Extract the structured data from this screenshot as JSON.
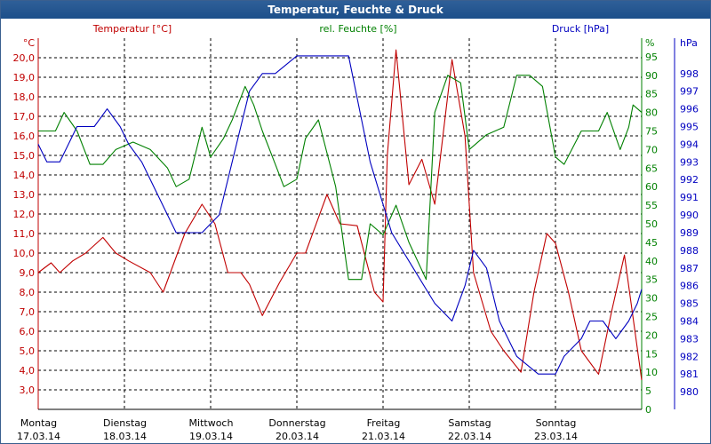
{
  "window": {
    "title": "Temperatur, Feuchte & Druck"
  },
  "legend": {
    "temperature": "Temperatur [°C]",
    "humidity": "rel. Feuchte [%]",
    "pressure": "Druck [hPa]"
  },
  "colors": {
    "temperature": "#c00000",
    "humidity": "#008000",
    "pressure": "#0000c0",
    "grid": "#000000"
  },
  "chart_data": {
    "type": "line",
    "title": "Temperatur, Feuchte & Druck",
    "grid": true,
    "x_unit": "days",
    "x_range": [
      0,
      7
    ],
    "x_ticks": [
      {
        "day": "Montag",
        "date": "17.03.14"
      },
      {
        "day": "Dienstag",
        "date": "18.03.14"
      },
      {
        "day": "Mittwoch",
        "date": "19.03.14"
      },
      {
        "day": "Donnerstag",
        "date": "20.03.14"
      },
      {
        "day": "Freitag",
        "date": "21.03.14"
      },
      {
        "day": "Samstag",
        "date": "22.03.14"
      },
      {
        "day": "Sonntag",
        "date": "23.03.14"
      }
    ],
    "axes": {
      "temperature": {
        "unit": "°C",
        "range": [
          2.0,
          21.0
        ],
        "ticks": [
          "3,0",
          "4,0",
          "5,0",
          "6,0",
          "7,0",
          "8,0",
          "9,0",
          "10,0",
          "11,0",
          "12,0",
          "13,0",
          "14,0",
          "15,0",
          "16,0",
          "17,0",
          "18,0",
          "19,0",
          "20,0"
        ]
      },
      "humidity": {
        "unit": "%",
        "range": [
          0,
          100
        ],
        "ticks": [
          "0",
          "5",
          "10",
          "15",
          "20",
          "25",
          "30",
          "35",
          "40",
          "45",
          "50",
          "55",
          "60",
          "65",
          "70",
          "75",
          "80",
          "85",
          "90",
          "95"
        ]
      },
      "pressure": {
        "unit": "hPa",
        "range": [
          979,
          1000
        ],
        "ticks": [
          "980",
          "981",
          "982",
          "983",
          "984",
          "985",
          "986",
          "987",
          "988",
          "989",
          "990",
          "991",
          "992",
          "993",
          "994",
          "995",
          "996",
          "997",
          "998"
        ]
      }
    },
    "series": [
      {
        "name": "Temperatur [°C]",
        "axis": "temperature",
        "x": [
          0,
          0.15,
          0.25,
          0.4,
          0.55,
          0.75,
          0.9,
          1.05,
          1.3,
          1.45,
          1.7,
          1.9,
          2.05,
          2.2,
          2.35,
          2.45,
          2.6,
          2.8,
          3.0,
          3.1,
          3.35,
          3.5,
          3.7,
          3.9,
          4.0,
          4.05,
          4.15,
          4.3,
          4.45,
          4.6,
          4.8,
          4.95,
          5.05,
          5.25,
          5.4,
          5.6,
          5.75,
          5.9,
          6.0,
          6.15,
          6.3,
          6.5,
          6.65,
          6.8,
          7.0
        ],
        "values": [
          9.0,
          9.5,
          9.0,
          9.6,
          10.0,
          10.8,
          10.0,
          9.6,
          9.0,
          8.0,
          11.0,
          12.5,
          11.5,
          9.0,
          9.0,
          8.4,
          6.8,
          8.5,
          10.0,
          10.0,
          13.0,
          11.5,
          11.4,
          8.0,
          7.5,
          15.0,
          20.4,
          13.5,
          14.8,
          12.5,
          19.9,
          16.0,
          9.0,
          6.0,
          5.0,
          3.9,
          8.0,
          11.0,
          10.5,
          8.0,
          5.0,
          3.8,
          7.0,
          9.9,
          3.5
        ]
      },
      {
        "name": "rel. Feuchte [%]",
        "axis": "humidity",
        "x": [
          0,
          0.2,
          0.3,
          0.45,
          0.6,
          0.75,
          0.9,
          1.1,
          1.3,
          1.5,
          1.6,
          1.75,
          1.9,
          2.0,
          2.15,
          2.25,
          2.4,
          2.5,
          2.6,
          2.75,
          2.85,
          3.0,
          3.1,
          3.25,
          3.45,
          3.6,
          3.75,
          3.85,
          4.0,
          4.15,
          4.3,
          4.5,
          4.6,
          4.75,
          4.9,
          5.0,
          5.2,
          5.4,
          5.55,
          5.7,
          5.85,
          6.0,
          6.1,
          6.3,
          6.5,
          6.6,
          6.75,
          6.85,
          6.9,
          7.0
        ],
        "values": [
          75,
          75,
          80,
          75,
          66,
          66,
          70,
          72,
          70,
          65,
          60,
          62,
          76,
          68,
          73,
          78,
          87,
          82,
          75,
          66,
          60,
          62,
          73,
          78,
          60,
          35,
          35,
          50,
          47,
          55,
          45,
          35,
          80,
          90,
          88,
          70,
          74,
          76,
          90,
          90,
          87,
          68,
          66,
          75,
          75,
          80,
          70,
          76,
          82,
          80
        ]
      },
      {
        "name": "Druck [hPa]",
        "axis": "pressure",
        "x": [
          0,
          0.1,
          0.25,
          0.45,
          0.65,
          0.8,
          0.95,
          1.05,
          1.2,
          1.4,
          1.6,
          1.9,
          2.1,
          2.3,
          2.45,
          2.6,
          2.75,
          3.0,
          3.2,
          3.4,
          3.6,
          3.85,
          4.1,
          4.35,
          4.6,
          4.8,
          4.95,
          5.05,
          5.2,
          5.35,
          5.55,
          5.8,
          6.0,
          6.1,
          6.3,
          6.4,
          6.55,
          6.7,
          6.85,
          6.95,
          7.0
        ],
        "values": [
          994,
          993,
          993,
          995,
          995,
          996,
          995,
          994,
          993,
          991,
          989,
          989,
          990,
          994,
          997,
          998,
          998,
          999,
          999,
          999,
          999,
          993,
          989,
          987,
          985,
          984,
          986,
          988,
          987,
          984,
          982,
          981,
          981,
          982,
          983,
          984,
          984,
          983,
          984,
          985,
          985.8
        ]
      }
    ]
  }
}
